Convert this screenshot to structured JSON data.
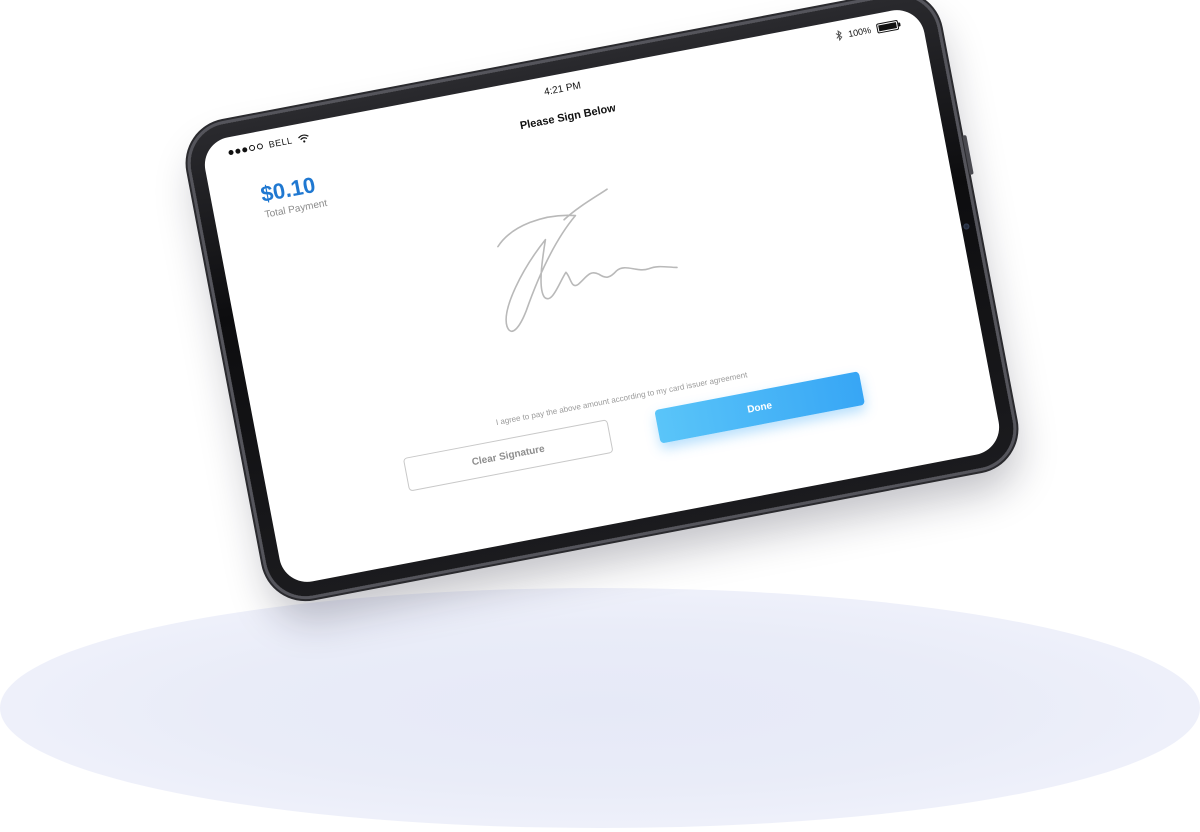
{
  "status_bar": {
    "carrier": "BELL",
    "time": "4:21 PM",
    "battery": "100%",
    "battery_level": 1.0,
    "icons": [
      "signal-dots-icon",
      "wifi-icon",
      "bluetooth-icon",
      "battery-icon"
    ]
  },
  "screen": {
    "title": "Please Sign Below",
    "amount": "$0.10",
    "amount_label": "Total Payment",
    "agreement_text": "I agree to pay the above amount according to my card issuer agreement",
    "clear_button": "Clear Signature",
    "done_button": "Done"
  },
  "colors": {
    "accent": "#1f78d1",
    "done_button_start": "#5ac5f9",
    "done_button_end": "#37a6f5",
    "device_bezel": "#111111",
    "floor_shadow": "#e6e9f7"
  }
}
